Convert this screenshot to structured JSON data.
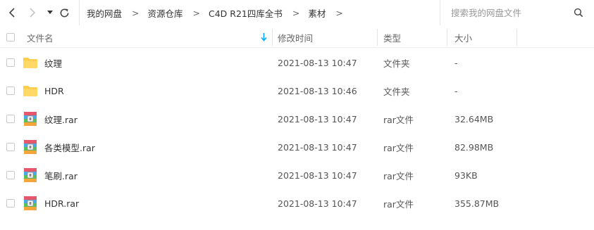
{
  "toolbar": {
    "back_icon": "chevron-left-icon",
    "forward_icon": "chevron-right-icon",
    "history_icon": "caret-down-icon",
    "refresh_icon": "refresh-icon"
  },
  "breadcrumb": {
    "items": [
      "我的网盘",
      "资源仓库",
      "C4D R21四库全书",
      "素材"
    ],
    "separator": ">"
  },
  "search": {
    "placeholder": "搜索我的网盘文件",
    "icon": "search-icon"
  },
  "table": {
    "columns": {
      "name": "文件名",
      "date": "修改时间",
      "type": "类型",
      "size": "大小"
    },
    "sort_icon": "sort-arrow-down-icon",
    "rows": [
      {
        "name": "纹理",
        "date": "2021-08-13 10:47",
        "type": "文件夹",
        "size": "-",
        "icon": "folder-icon"
      },
      {
        "name": "HDR",
        "date": "2021-08-13 10:46",
        "type": "文件夹",
        "size": "-",
        "icon": "folder-icon"
      },
      {
        "name": "纹理.rar",
        "date": "2021-08-13 10:47",
        "type": "rar文件",
        "size": "32.64MB",
        "icon": "archive-icon"
      },
      {
        "name": "各类模型.rar",
        "date": "2021-08-13 10:47",
        "type": "rar文件",
        "size": "82.98MB",
        "icon": "archive-icon"
      },
      {
        "name": "笔刷.rar",
        "date": "2021-08-13 10:47",
        "type": "rar文件",
        "size": "93KB",
        "icon": "archive-icon"
      },
      {
        "name": "HDR.rar",
        "date": "2021-08-13 10:47",
        "type": "rar文件",
        "size": "355.87MB",
        "icon": "archive-icon"
      }
    ]
  },
  "colors": {
    "accent": "#06a7ff",
    "folder": "#ffcd4d",
    "text": "#333333",
    "muted": "#666666"
  }
}
